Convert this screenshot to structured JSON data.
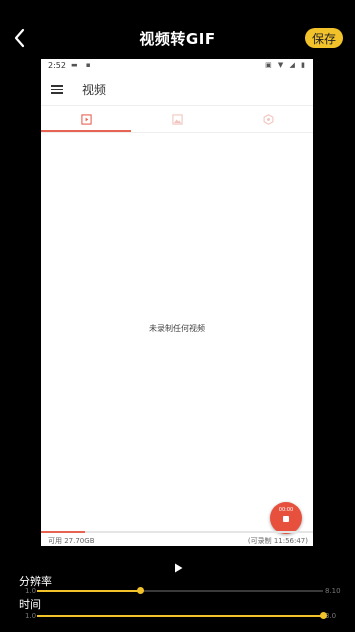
{
  "header": {
    "title": "视频转GIF",
    "save_label": "保存",
    "back_icon": "chevron-left-icon"
  },
  "preview": {
    "status": {
      "time": "2:52"
    },
    "appbar": {
      "title": "视频"
    },
    "tabs": [
      {
        "icon": "video-icon",
        "active": true
      },
      {
        "icon": "image-icon",
        "active": false
      },
      {
        "icon": "hexagon-icon",
        "active": false
      }
    ],
    "empty_text": "未录制任何视频",
    "fab": {
      "time": "00:00"
    },
    "storage": {
      "available": "可用 27.70GB",
      "recordable": "(可录制 11:56:47)",
      "used_fraction": 0.16
    },
    "accent": "#e86452"
  },
  "controls": {
    "play_icon": "play-icon",
    "resolution": {
      "label": "分辨率",
      "min": "1.0",
      "max": "8.10",
      "fraction": 0.36
    },
    "duration": {
      "label": "时间",
      "min": "1.0",
      "max": "3.0",
      "fraction": 1.0
    },
    "accent": "#f2c22b"
  }
}
